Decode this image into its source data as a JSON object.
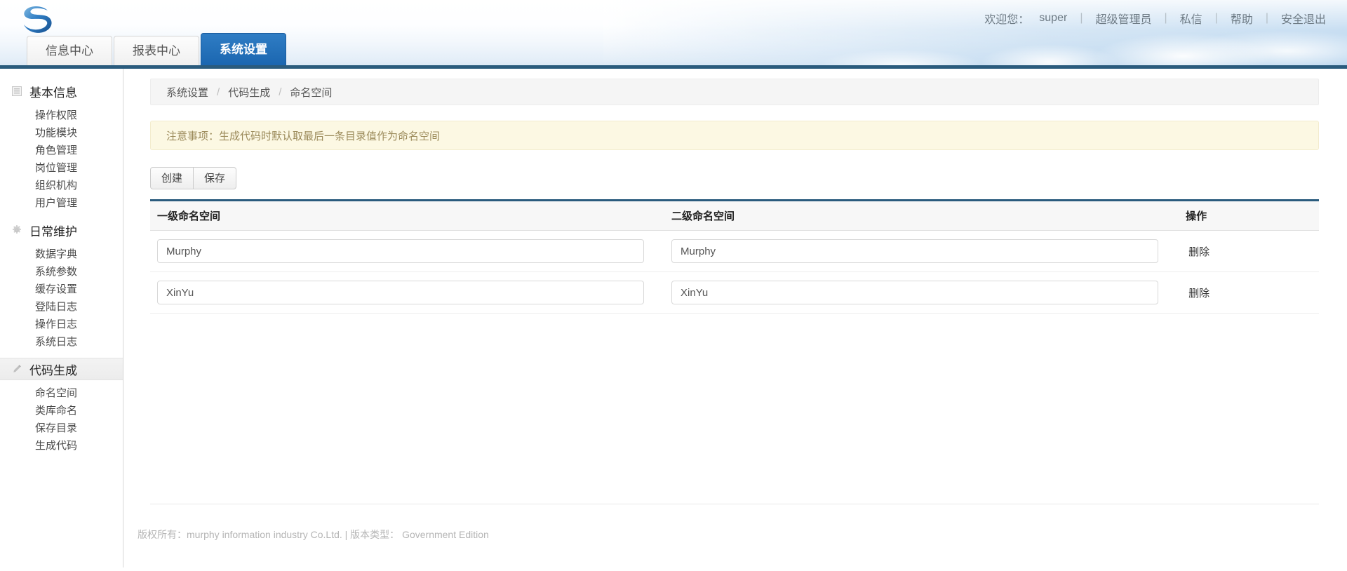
{
  "header": {
    "logo_name": "brand-logo",
    "welcome_label": "欢迎您：",
    "username": "super",
    "sep": "|",
    "links": [
      {
        "label": "超级管理员",
        "name": "role-link"
      },
      {
        "label": "私信",
        "name": "messages-link"
      },
      {
        "label": "帮助",
        "name": "help-link"
      },
      {
        "label": "安全退出",
        "name": "logout-link"
      }
    ],
    "tabs": [
      {
        "label": "信息中心",
        "active": false
      },
      {
        "label": "报表中心",
        "active": false
      },
      {
        "label": "系统设置",
        "active": true
      }
    ]
  },
  "sidebar": {
    "groups": [
      {
        "label": "基本信息",
        "icon": "list-icon",
        "active": false,
        "items": [
          "操作权限",
          "功能模块",
          "角色管理",
          "岗位管理",
          "组织机构",
          "用户管理"
        ]
      },
      {
        "label": "日常维护",
        "icon": "gear-icon",
        "active": false,
        "items": [
          "数据字典",
          "系统参数",
          "缓存设置",
          "登陆日志",
          "操作日志",
          "系统日志"
        ]
      },
      {
        "label": "代码生成",
        "icon": "pencil-icon",
        "active": true,
        "items": [
          "命名空间",
          "类库命名",
          "保存目录",
          "生成代码"
        ]
      }
    ]
  },
  "breadcrumb": {
    "items": [
      "系统设置",
      "代码生成",
      "命名空间"
    ],
    "separator": "/"
  },
  "notice": {
    "text": "注意事项：生成代码时默认取最后一条目录值作为命名空间"
  },
  "toolbar": {
    "create_label": "创建",
    "save_label": "保存"
  },
  "table": {
    "headers": [
      "一级命名空间",
      "二级命名空间",
      "操作"
    ],
    "rows": [
      {
        "level1": "Murphy",
        "level2": "Murphy",
        "action": "删除"
      },
      {
        "level1": "XinYu",
        "level2": "XinYu",
        "action": "删除"
      }
    ],
    "input_placeholder": ""
  },
  "footer": {
    "text": "版权所有：murphy information industry Co.Ltd. | 版本类型： Government Edition"
  },
  "colors": {
    "accent_blue": "#1b66b0",
    "rule_dark": "#2a5b7d",
    "notice_bg": "#fcf8e3",
    "notice_text": "#9b8a5a"
  }
}
